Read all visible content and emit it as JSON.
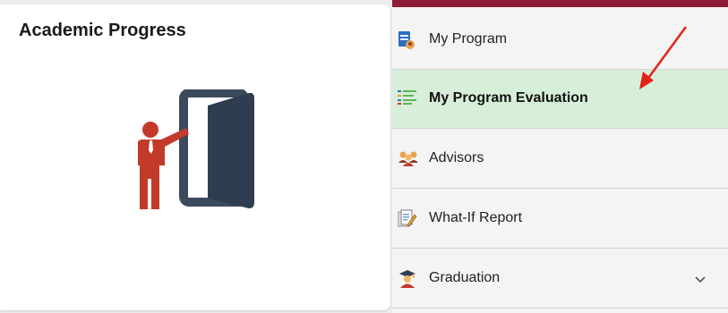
{
  "tile": {
    "title": "Academic Progress",
    "icon": "teacher-door-icon"
  },
  "nav": {
    "items": [
      {
        "label": "My Program",
        "icon": "program-document-icon"
      },
      {
        "label": "My Program Evaluation",
        "icon": "checklist-icon",
        "selected": true
      },
      {
        "label": "Advisors",
        "icon": "people-group-icon"
      },
      {
        "label": "What-If Report",
        "icon": "report-edit-icon"
      },
      {
        "label": "Graduation",
        "icon": "graduation-cap-icon",
        "expandable": true
      }
    ]
  },
  "colors": {
    "accent_bar": "#8e1b3a",
    "selected_bg": "#d7eed9",
    "arrow": "#e3221b"
  }
}
